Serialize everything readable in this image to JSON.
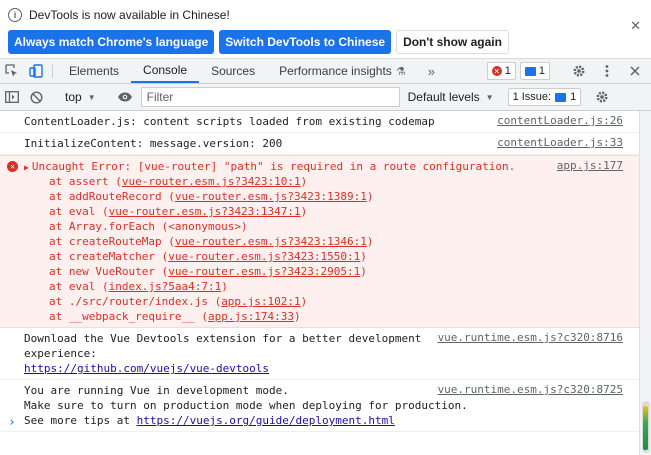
{
  "infobar": {
    "message": "DevTools is now available in Chinese!",
    "buttons": [
      "Always match Chrome's language",
      "Switch DevTools to Chinese",
      "Don't show again"
    ],
    "close_glyph": "✕"
  },
  "tabs": {
    "items": [
      "Elements",
      "Console",
      "Sources",
      "Performance insights"
    ],
    "active": "Console",
    "more": "»",
    "error_count": "1",
    "message_count": "1"
  },
  "console_toolbar": {
    "context": "top",
    "filter_placeholder": "Filter",
    "levels": "Default levels",
    "issues": "1 Issue:",
    "issue_count": "1"
  },
  "log": {
    "entry1": {
      "text": "ContentLoader.js: content scripts loaded from existing codemap",
      "source": "contentLoader.js:26"
    },
    "entry2": {
      "text": "InitializeContent: message.version: 200",
      "source": "contentLoader.js:33"
    },
    "error": {
      "message": "Uncaught Error: [vue-router] \"path\" is required in a route configuration.",
      "source": "app.js:177",
      "stack": [
        {
          "pre": "at assert (",
          "link": "vue-router.esm.js?3423:10:1",
          "post": ")"
        },
        {
          "pre": "at addRouteRecord (",
          "link": "vue-router.esm.js?3423:1389:1",
          "post": ")"
        },
        {
          "pre": "at eval (",
          "link": "vue-router.esm.js?3423:1347:1",
          "post": ")"
        },
        {
          "pre": "at Array.forEach (<anonymous>)",
          "link": "",
          "post": ""
        },
        {
          "pre": "at createRouteMap (",
          "link": "vue-router.esm.js?3423:1346:1",
          "post": ")"
        },
        {
          "pre": "at createMatcher (",
          "link": "vue-router.esm.js?3423:1550:1",
          "post": ")"
        },
        {
          "pre": "at new VueRouter (",
          "link": "vue-router.esm.js?3423:2905:1",
          "post": ")"
        },
        {
          "pre": "at eval (",
          "link": "index.js?5aa4:7:1",
          "post": ")"
        },
        {
          "pre": "at ./src/router/index.js (",
          "link": "app.js:102:1",
          "post": ")"
        },
        {
          "pre": "at __webpack_require__ (",
          "link": "app.js:174:33",
          "post": ")"
        }
      ]
    },
    "devtools": {
      "line1": "Download the Vue Devtools extension for a better development",
      "line2": "experience:",
      "link": "https://github.com/vuejs/vue-devtools",
      "source": "vue.runtime.esm.js?c320:8716"
    },
    "devmode": {
      "line1": "You are running Vue in development mode.",
      "line2": "Make sure to turn on production mode when deploying for production.",
      "line3_pre": "See more tips at ",
      "link": "https://vuejs.org/guide/deployment.html",
      "source": "vue.runtime.esm.js?c320:8725"
    },
    "prompt": "›"
  },
  "colors": {
    "accent": "#1a73e8",
    "error": "#d93025",
    "error_bg": "#fff0f0"
  }
}
